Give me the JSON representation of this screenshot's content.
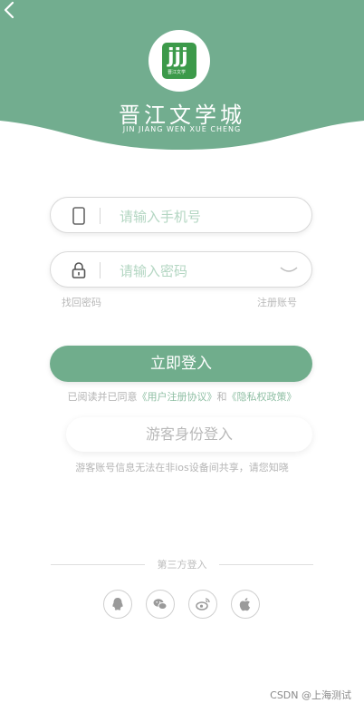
{
  "header": {
    "brand_cn": "晋江文学城",
    "brand_en": "JIN JIANG WEN XUE CHENG",
    "logo_mark": "jjj",
    "logo_small": "晋江文学",
    "bg_color": "#72ad8f"
  },
  "form": {
    "phone_placeholder": "请输入手机号",
    "password_placeholder": "请输入密码",
    "forgot_password": "找回密码",
    "register": "注册账号"
  },
  "login_button": "立即登入",
  "agreement": {
    "prefix": "已阅读并已同意",
    "user_agreement": "《用户注册协议》",
    "and": "和",
    "privacy_policy": "《隐私权政策》"
  },
  "guest_button": "游客身份登入",
  "guest_note": "游客账号信息无法在非ios设备间共享，请您知晓",
  "third_party": {
    "label": "第三方登入",
    "icons": [
      "qq-icon",
      "wechat-icon",
      "weibo-icon",
      "apple-icon"
    ]
  },
  "watermark": "CSDN @上海测试"
}
